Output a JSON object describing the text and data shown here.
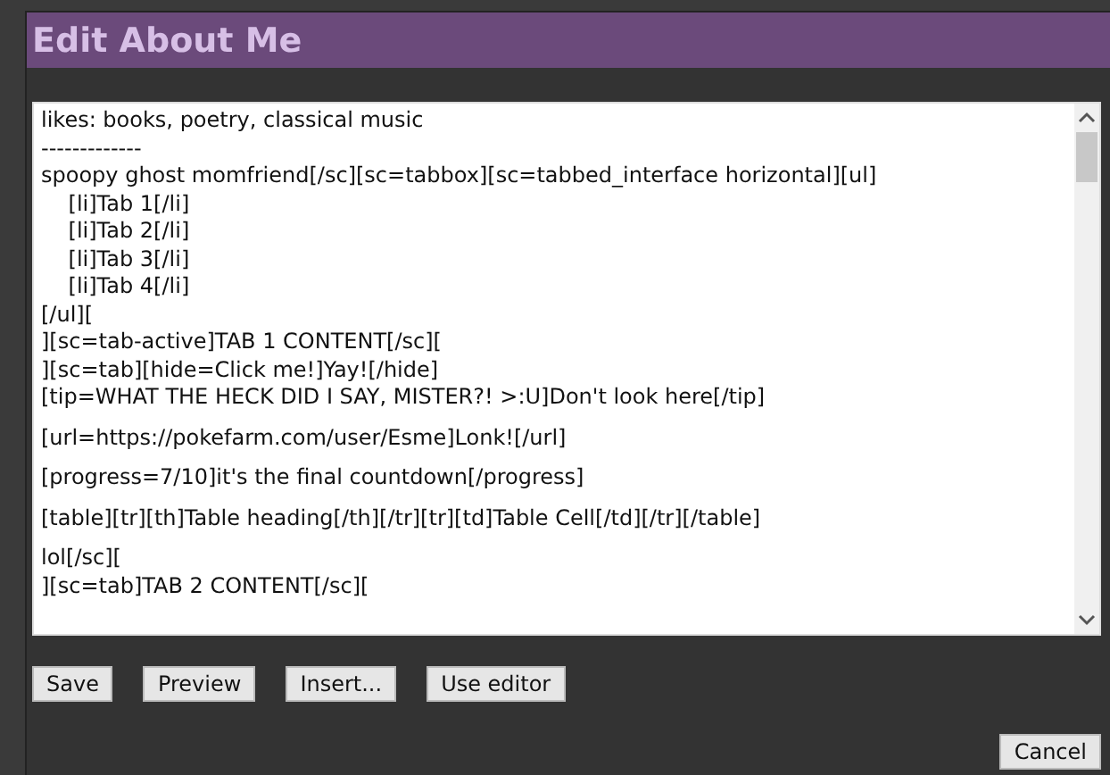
{
  "dialog": {
    "title": "Edit About Me",
    "editor_lines": [
      {
        "text": "likes: books, poetry, classical music",
        "space_before": false
      },
      {
        "text": "-------------",
        "space_before": false
      },
      {
        "text": "spoopy ghost momfriend[/sc][sc=tabbox][sc=tabbed_interface horizontal][ul]",
        "space_before": false
      },
      {
        "text": "    [li]Tab 1[/li]",
        "space_before": false
      },
      {
        "text": "    [li]Tab 2[/li]",
        "space_before": false
      },
      {
        "text": "    [li]Tab 3[/li]",
        "space_before": false
      },
      {
        "text": "    [li]Tab 4[/li]",
        "space_before": false
      },
      {
        "text": "[/ul][",
        "space_before": false
      },
      {
        "text": "][sc=tab-active]TAB 1 CONTENT[/sc][",
        "space_before": false
      },
      {
        "text": "][sc=tab][hide=Click me!]Yay![/hide]",
        "space_before": false
      },
      {
        "text": "[tip=WHAT THE HECK DID I SAY, MISTER?! >:U]Don't look here[/tip]",
        "space_before": false
      },
      {
        "text": "[url=https://pokefarm.com/user/Esme]Lonk![/url]",
        "space_before": true
      },
      {
        "text": "[progress=7/10]it's the final countdown[/progress]",
        "space_before": true
      },
      {
        "text": "[table][tr][th]Table heading[/th][/tr][tr][td]Table Cell[/td][/tr][/table]",
        "space_before": true
      },
      {
        "text": "lol[/sc][",
        "space_before": true
      },
      {
        "text": "][sc=tab]TAB 2 CONTENT[/sc][",
        "space_before": false
      }
    ],
    "buttons": [
      "Save",
      "Preview",
      "Insert...",
      "Use editor"
    ],
    "cancel_button": "Cancel"
  }
}
